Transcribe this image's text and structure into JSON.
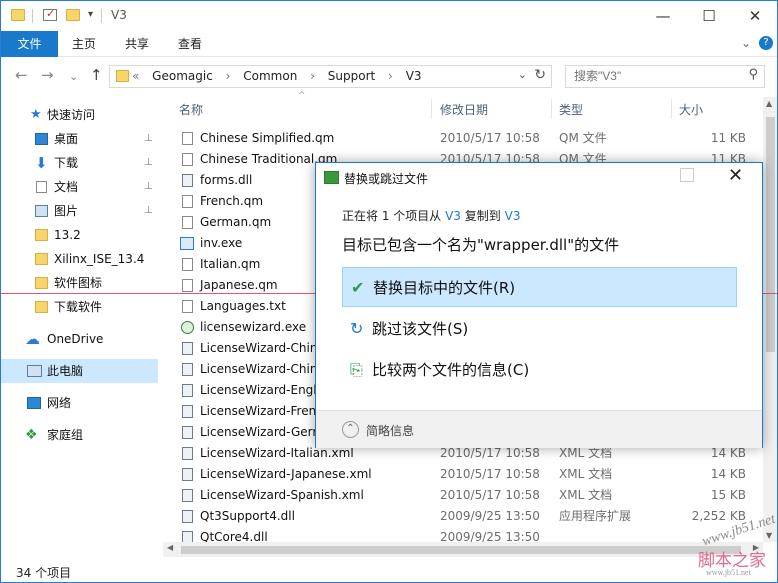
{
  "window": {
    "title": "V3",
    "minimize_glyph": "—",
    "maximize_glyph": "☐",
    "close_glyph": "✕",
    "quick_access_dropdown": "▾"
  },
  "ribbon": {
    "tabs": [
      "文件",
      "主页",
      "共享",
      "查看"
    ],
    "collapse_glyph": "⌄",
    "help_glyph": "?"
  },
  "address": {
    "back": "←",
    "forward": "→",
    "recent": "⌄",
    "up": "↑",
    "prefix": "«",
    "crumbs": [
      "Geomagic",
      "Common",
      "Support",
      "V3"
    ],
    "crumb_sep": "›",
    "dropdown": "⌄",
    "refresh": "↻"
  },
  "search": {
    "placeholder": "搜索\"V3\"",
    "icon": "⚲"
  },
  "nav": {
    "items": [
      {
        "label": "快速访问",
        "icon": "star-icon"
      },
      {
        "label": "桌面",
        "icon": "desktop-icon",
        "pinned": true
      },
      {
        "label": "下载",
        "icon": "download-icon",
        "pinned": true
      },
      {
        "label": "文档",
        "icon": "document-icon",
        "pinned": true
      },
      {
        "label": "图片",
        "icon": "picture-icon",
        "pinned": true
      },
      {
        "label": "13.2",
        "icon": "folder-icon"
      },
      {
        "label": "Xilinx_ISE_13.4",
        "icon": "folder-icon"
      },
      {
        "label": "软件图标",
        "icon": "folder-icon"
      },
      {
        "label": "下载软件",
        "icon": "folder-icon"
      },
      {
        "label": "OneDrive",
        "icon": "cloud-icon"
      },
      {
        "label": "此电脑",
        "icon": "computer-icon",
        "selected": true
      },
      {
        "label": "网络",
        "icon": "network-icon"
      },
      {
        "label": "家庭组",
        "icon": "homegroup-icon"
      }
    ],
    "pin_glyph": "📌"
  },
  "columns": {
    "name": "名称",
    "date": "修改日期",
    "type": "类型",
    "size": "大小",
    "sort_glyph": "^"
  },
  "files": [
    {
      "name": "Chinese Simplified.qm",
      "date": "2010/5/17 10:58",
      "type": "QM 文件",
      "size": "11 KB"
    },
    {
      "name": "Chinese Traditional.qm",
      "date": "2010/5/17 10:58",
      "type": "QM 文件",
      "size": "11 KB"
    },
    {
      "name": "forms.dll",
      "date": "",
      "type": "",
      "size": ""
    },
    {
      "name": "French.qm",
      "date": "",
      "type": "",
      "size": ""
    },
    {
      "name": "German.qm",
      "date": "",
      "type": "",
      "size": ""
    },
    {
      "name": "inv.exe",
      "date": "",
      "type": "",
      "size": ""
    },
    {
      "name": "Italian.qm",
      "date": "",
      "type": "",
      "size": ""
    },
    {
      "name": "Japanese.qm",
      "date": "",
      "type": "",
      "size": ""
    },
    {
      "name": "Languages.txt",
      "date": "",
      "type": "",
      "size": ""
    },
    {
      "name": "licensewizard.exe",
      "date": "",
      "type": "",
      "size": ""
    },
    {
      "name": "LicenseWizard-Chin",
      "date": "",
      "type": "",
      "size": ""
    },
    {
      "name": "LicenseWizard-Chin",
      "date": "",
      "type": "",
      "size": ""
    },
    {
      "name": "LicenseWizard-Engl",
      "date": "",
      "type": "",
      "size": ""
    },
    {
      "name": "LicenseWizard-Fren",
      "date": "",
      "type": "",
      "size": ""
    },
    {
      "name": "LicenseWizard-Gerr",
      "date": "",
      "type": "",
      "size": ""
    },
    {
      "name": "LicenseWizard-Italian.xml",
      "date": "2010/5/17 10:58",
      "type": "XML 文档",
      "size": "14 KB"
    },
    {
      "name": "LicenseWizard-Japanese.xml",
      "date": "2010/5/17 10:58",
      "type": "XML 文档",
      "size": "14 KB"
    },
    {
      "name": "LicenseWizard-Spanish.xml",
      "date": "2010/5/17 10:58",
      "type": "XML 文档",
      "size": "15 KB"
    },
    {
      "name": "Qt3Support4.dll",
      "date": "2009/9/25 13:50",
      "type": "应用程序扩展",
      "size": "2,252 KB"
    },
    {
      "name": "QtCore4.dll",
      "date": "2009/9/25 13:50",
      "type": "",
      "size": ""
    }
  ],
  "status": {
    "count": "34 个项目"
  },
  "dialog": {
    "title": "替换或跳过文件",
    "progress_pre": "正在将 1 个项目从",
    "source": "V3",
    "progress_mid": "复制到",
    "dest": "V3",
    "heading": "目标已包含一个名为\"wrapper.dll\"的文件",
    "options": [
      {
        "icon": "✔",
        "label": "替换目标中的文件(R)"
      },
      {
        "icon": "↻",
        "label": "跳过该文件(S)"
      },
      {
        "icon": "⎘",
        "label": "比较两个文件的信息(C)"
      }
    ],
    "footer": "简略信息",
    "footer_glyph": "⌃",
    "close": "✕"
  },
  "watermark": {
    "line1": "www.jb51.net",
    "line2": "脚本之家",
    "line3": "www.jb51.net"
  }
}
